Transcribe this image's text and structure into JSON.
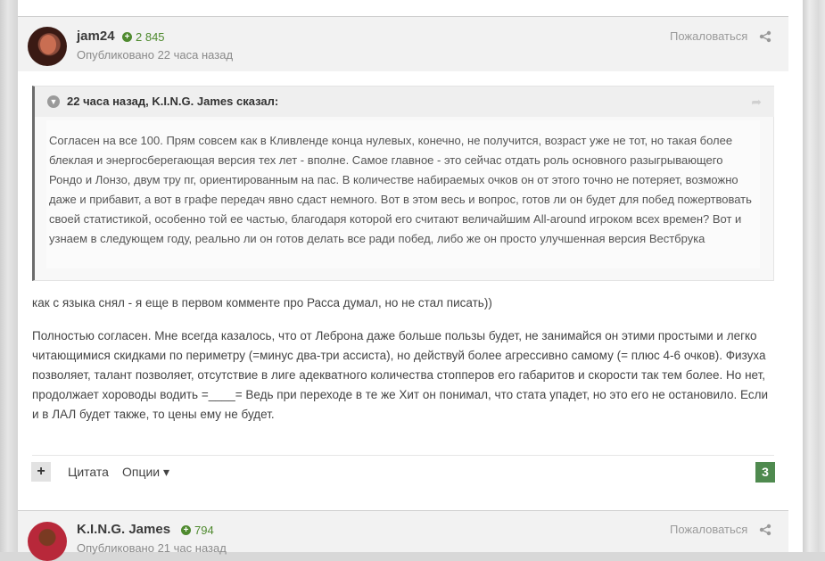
{
  "post1": {
    "username": "jam24",
    "reputation": "2 845",
    "published": "Опубликовано 22 часа назад",
    "report": "Пожаловаться",
    "quote": {
      "citation": "22 часа назад, K.I.N.G. James сказал:",
      "text": "Согласен на все 100. Прям совсем как в Кливленде конца нулевых, конечно, не получится, возраст уже не тот, но такая более блеклая и энергосберегающая версия тех лет - вполне. Самое главное - это сейчас отдать роль основного разыгрывающего Рондо и Лонзо, двум тру пг, ориентированным на пас. В количестве набираемых очков он от этого точно не потеряет, возможно даже и прибавит, а вот в графе передач явно сдаст немного. Вот в этом весь и вопрос, готов ли он будет для побед пожертвовать своей статистикой, особенно той ее частью, благодаря которой его считают величайшим All-around игроком всех времен? Вот и узнаем в следующем году, реально ли он готов делать все ради побед, либо же он просто улучшенная версия Вестбрука"
    },
    "paragraph1": "как с языка снял - я еще в первом комменте про Расса думал, но не стал писать))",
    "paragraph2": "Полностью согласен. Мне всегда казалось, что от Леброна даже больше пользы будет, не занимайся он этими простыми и легко читающимися скидками по периметру (=минус два-три ассиста), но действуй более агрессивно самому (= плюс 4-6 очков). Физуха позволяет, талант позволяет, отсутствие в лиге адекватного количества стопперов его габаритов и скорости так тем более. Но нет, продолжает хороводы водить =____= Ведь при переходе в те же Хит он понимал, что стата упадет, но это его не остановило. Если и в ЛАЛ будет также, то цены ему не будет.",
    "actions": {
      "plus": "+",
      "quote": "Цитата",
      "options": "Опции",
      "options_caret": "▾"
    },
    "reaction_count": "3"
  },
  "post2": {
    "username": "K.I.N.G. James",
    "reputation": "794",
    "published": "Опубликовано 21 час назад",
    "report": "Пожаловаться"
  },
  "icons": {
    "rep": "plus-circle-icon",
    "share": "share-icon",
    "toggle": "chevron-down-icon",
    "reply": "reply-arrow-icon"
  },
  "colors": {
    "reputation": "#4f8a2f",
    "badge": "#4f8a4f",
    "header_bg": "#f2f2f2"
  }
}
